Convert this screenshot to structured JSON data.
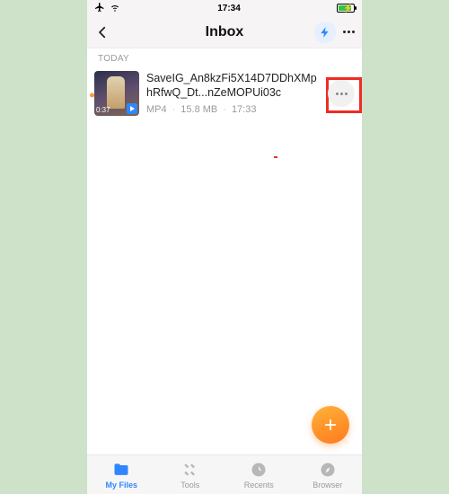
{
  "statusbar": {
    "time": "17:34"
  },
  "navbar": {
    "title": "Inbox"
  },
  "section_label": "TODAY",
  "file": {
    "name": "SaveIG_An8kzFi5X14D7DDhXMphRfwQ_Dt...nZeMOPUi03c",
    "duration": "0:37",
    "format": "MP4",
    "size": "15.8 MB",
    "time": "17:33"
  },
  "tabs": {
    "myfiles": "My Files",
    "tools": "Tools",
    "recents": "Recents",
    "browser": "Browser"
  },
  "icons": {
    "airplane": "✈",
    "wifi": "wifi",
    "back": "chevron-left",
    "bolt": "bolt",
    "more": "ellipsis",
    "plus": "plus"
  },
  "colors": {
    "accent": "#2f87ff",
    "fab_start": "#ffb23a",
    "fab_end": "#ff7a1e",
    "highlight": "#ef2b23",
    "page_bg": "#cde2c9"
  }
}
